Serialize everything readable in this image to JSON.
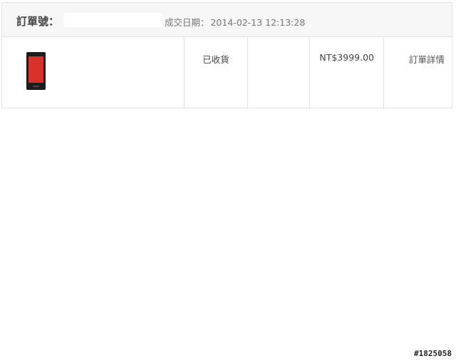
{
  "order": {
    "number_label": "訂單號：",
    "date_label": "成交日期：",
    "date_value": "2014-02-13 12:13:28"
  },
  "item": {
    "image_icon": "phone-product-image",
    "status": "已收貨",
    "price": "NT$3999.00",
    "detail_link": "訂單詳情"
  },
  "watermark": "#1825058"
}
